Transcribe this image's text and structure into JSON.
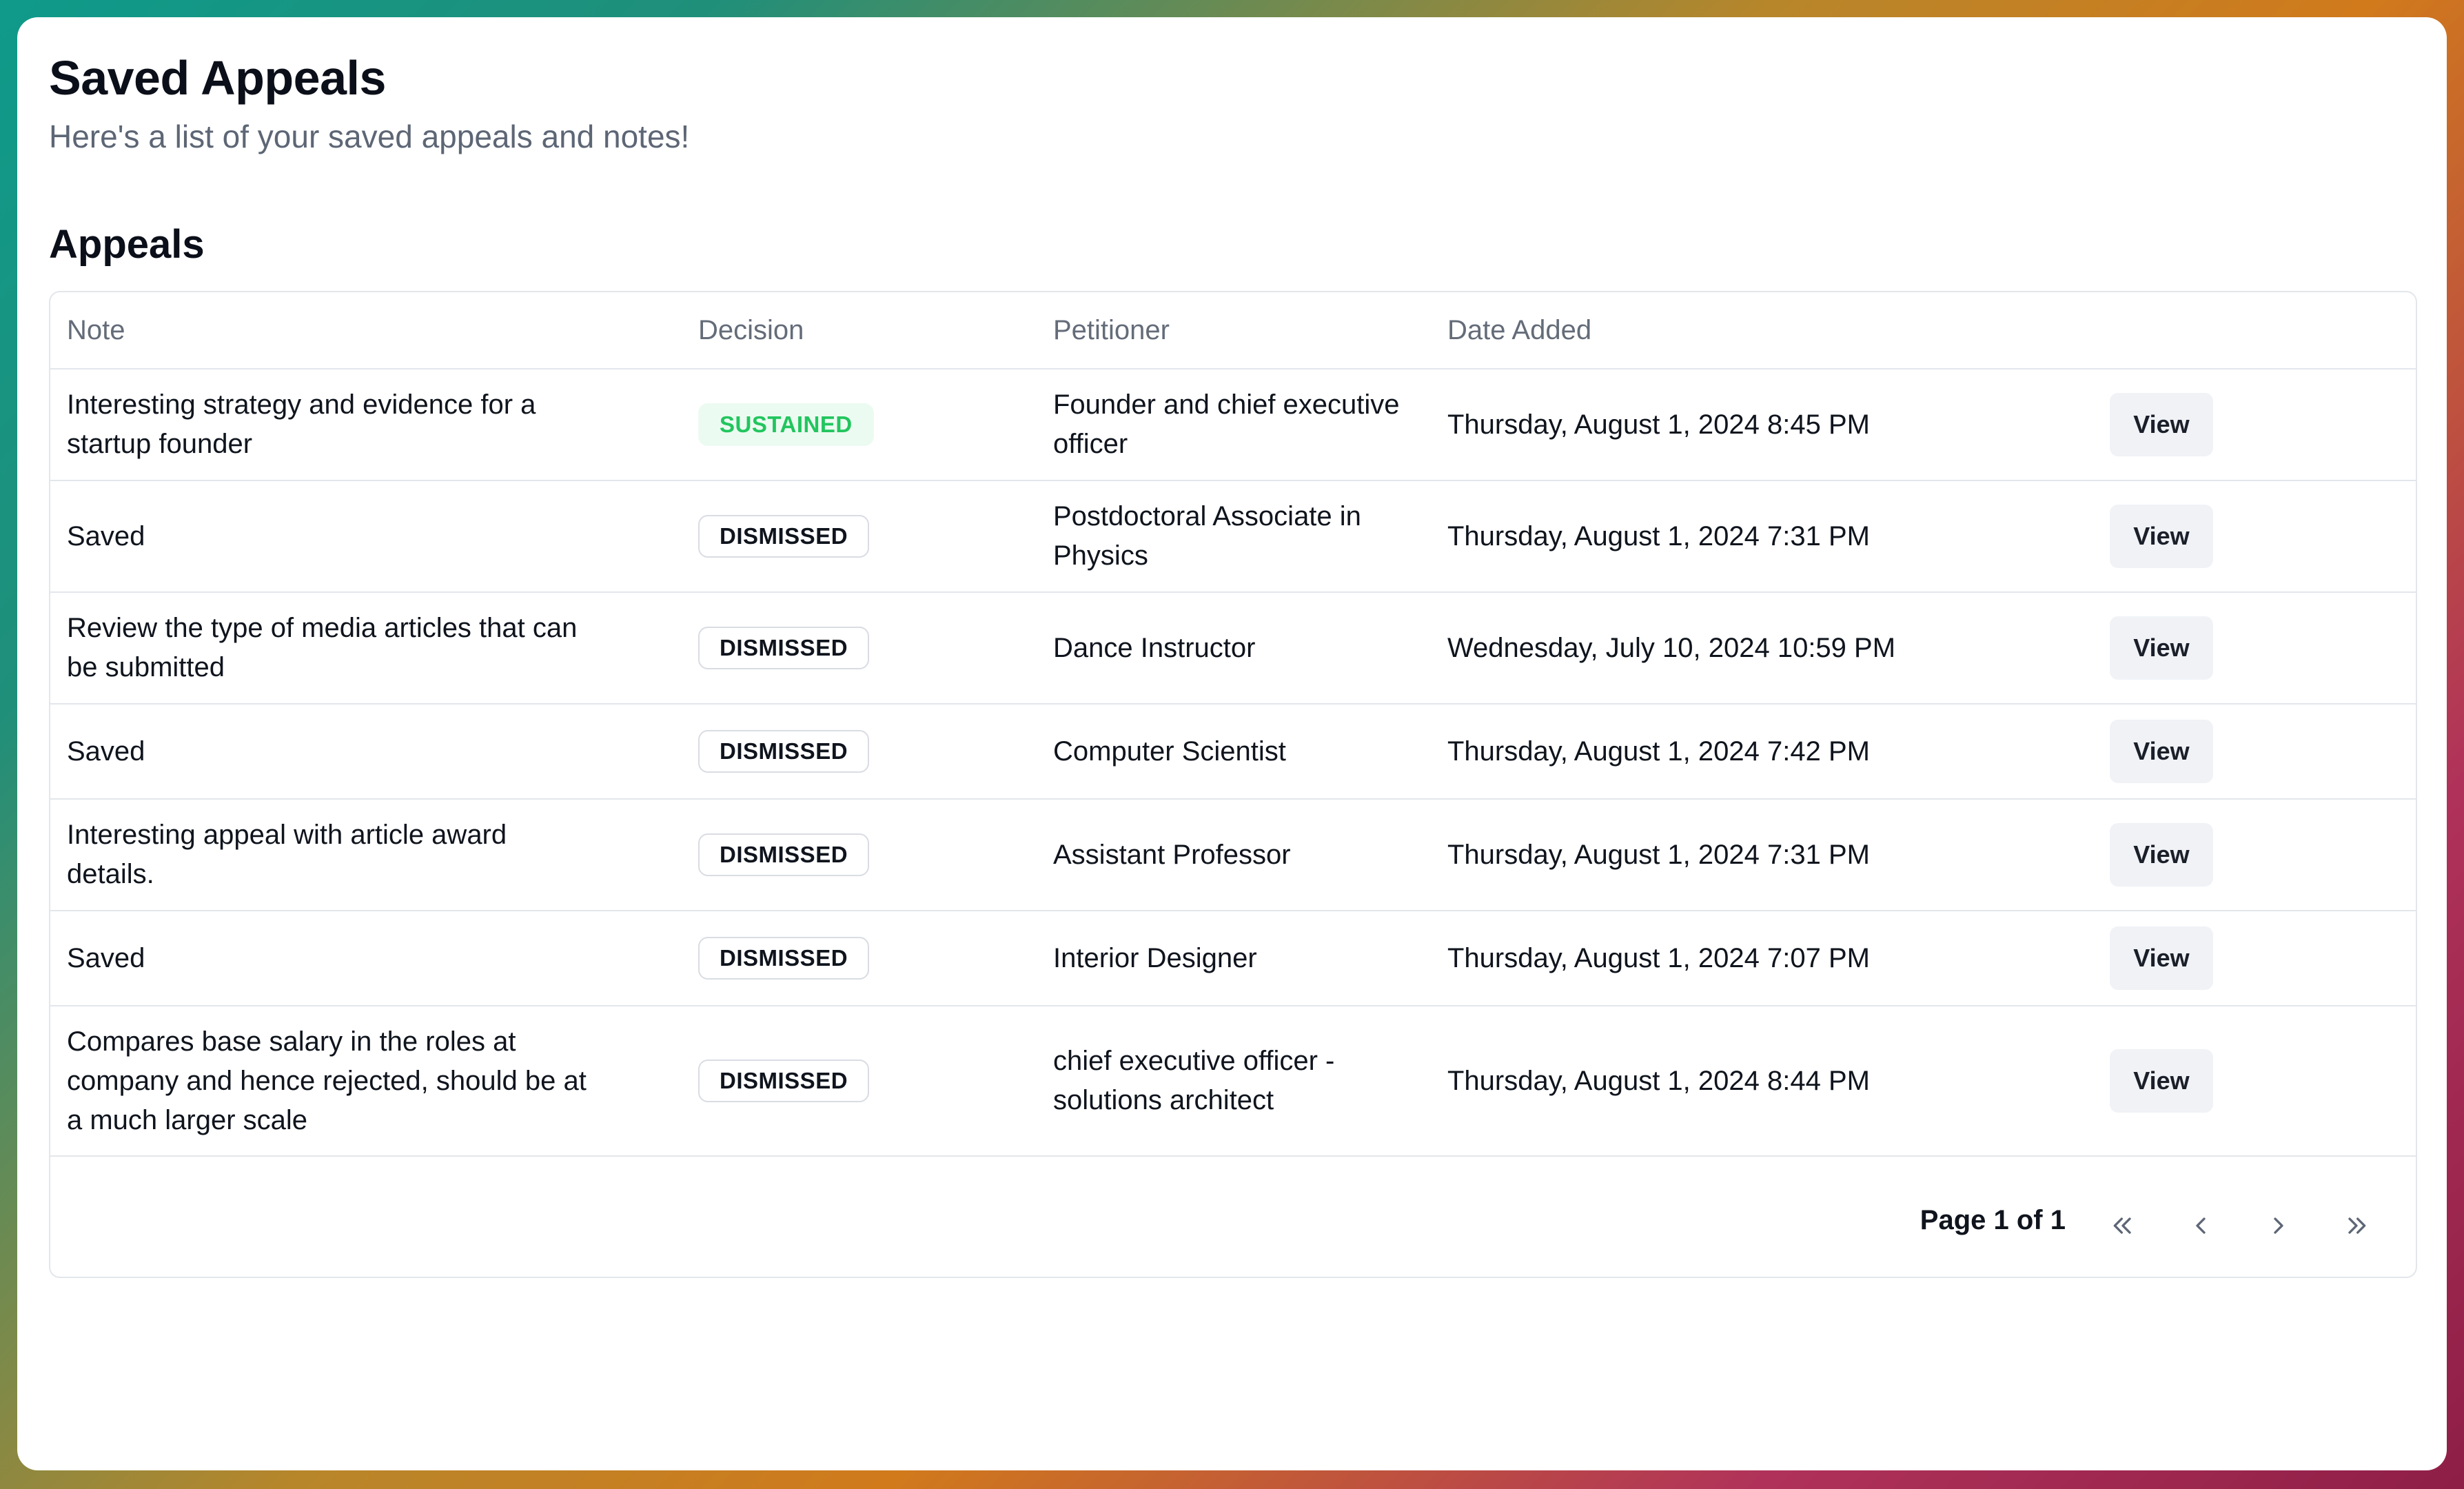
{
  "page": {
    "title": "Saved Appeals",
    "subtitle": "Here's a list of your saved appeals and notes!",
    "section_title": "Appeals"
  },
  "table": {
    "columns": [
      "Note",
      "Decision",
      "Petitioner",
      "Date Added"
    ],
    "rows": [
      {
        "note": "Interesting strategy and evidence for a startup founder",
        "decision": "SUSTAINED",
        "decision_status": "sustained",
        "petitioner": "Founder and chief executive officer",
        "date_added": "Thursday, August 1, 2024 8:45 PM",
        "action": "View"
      },
      {
        "note": "Saved",
        "decision": "DISMISSED",
        "decision_status": "dismissed",
        "petitioner": "Postdoctoral Associate in Physics",
        "date_added": "Thursday, August 1, 2024 7:31 PM",
        "action": "View"
      },
      {
        "note": "Review the type of media articles that can be submitted",
        "decision": "DISMISSED",
        "decision_status": "dismissed",
        "petitioner": "Dance Instructor",
        "date_added": "Wednesday, July 10, 2024 10:59 PM",
        "action": "View"
      },
      {
        "note": "Saved",
        "decision": "DISMISSED",
        "decision_status": "dismissed",
        "petitioner": "Computer Scientist",
        "date_added": "Thursday, August 1, 2024 7:42 PM",
        "action": "View"
      },
      {
        "note": "Interesting appeal with article award details.",
        "decision": "DISMISSED",
        "decision_status": "dismissed",
        "petitioner": "Assistant Professor",
        "date_added": "Thursday, August 1, 2024 7:31 PM",
        "action": "View"
      },
      {
        "note": "Saved",
        "decision": "DISMISSED",
        "decision_status": "dismissed",
        "petitioner": "Interior Designer",
        "date_added": "Thursday, August 1, 2024 7:07 PM",
        "action": "View"
      },
      {
        "note": "Compares base salary in the roles at company and hence rejected, should be at a much larger scale",
        "decision": "DISMISSED",
        "decision_status": "dismissed",
        "petitioner": "chief executive officer -solutions architect",
        "date_added": "Thursday, August 1, 2024 8:44 PM",
        "action": "View"
      }
    ]
  },
  "pagination": {
    "label": "Page 1 of 1",
    "icons": [
      "chevrons-left-icon",
      "chevron-left-icon",
      "chevron-right-icon",
      "chevrons-right-icon"
    ]
  },
  "colors": {
    "sustained_text": "#22c55e",
    "sustained_bg": "#ecfbf1",
    "border": "#e3e6eb",
    "button_bg": "#f0f2f6"
  }
}
